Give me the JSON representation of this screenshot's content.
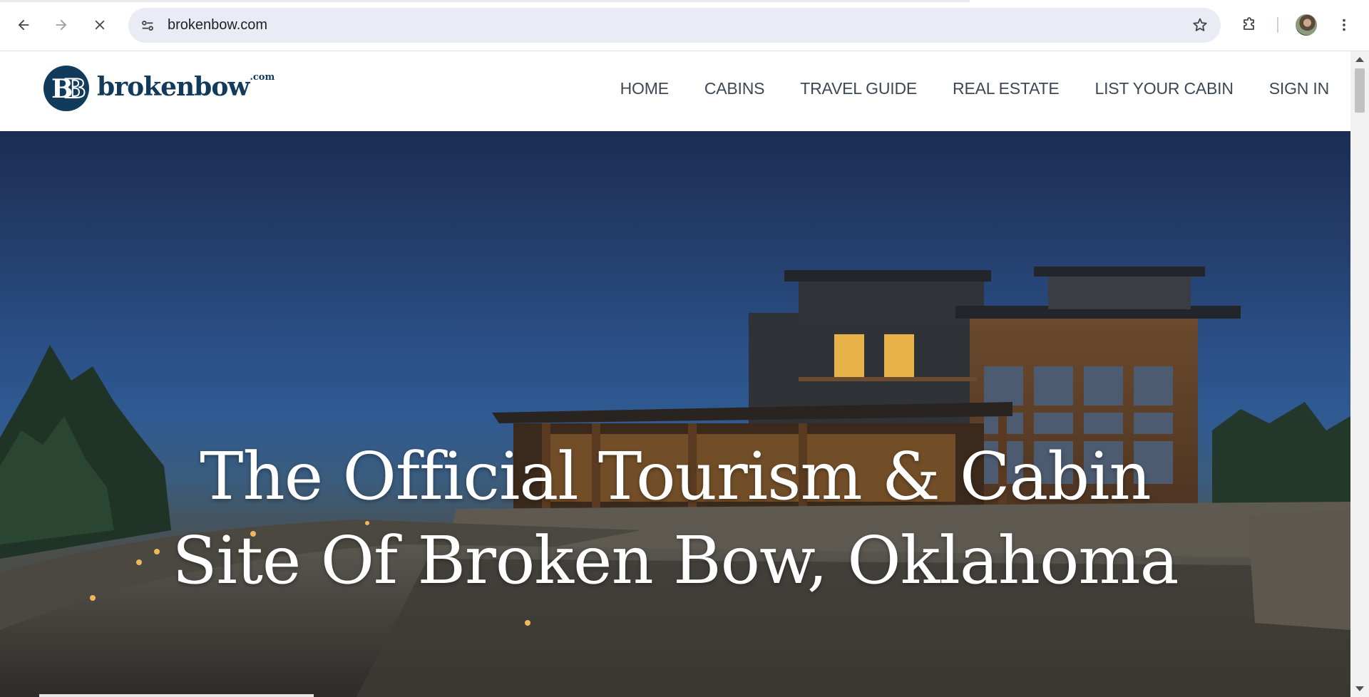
{
  "browser": {
    "url": "brokenbow.com",
    "icons": {
      "back": "arrow-left-icon",
      "forward": "arrow-right-icon",
      "stop": "close-icon",
      "site_info": "tune-icon",
      "bookmark": "star-icon",
      "extensions": "puzzle-icon",
      "profile": "avatar",
      "menu": "more-vert-icon"
    }
  },
  "site": {
    "logo_text": "brokenbow",
    "logo_suffix": ".com",
    "brand_color": "#123a5b",
    "nav": [
      {
        "label": "HOME"
      },
      {
        "label": "CABINS"
      },
      {
        "label": "TRAVEL GUIDE"
      },
      {
        "label": "REAL ESTATE"
      },
      {
        "label": "LIST YOUR CABIN"
      },
      {
        "label": "SIGN IN"
      }
    ]
  },
  "hero": {
    "title_line1": "The Official Tourism & Cabin",
    "title_line2": "Site Of Broken Bow, Oklahoma"
  }
}
